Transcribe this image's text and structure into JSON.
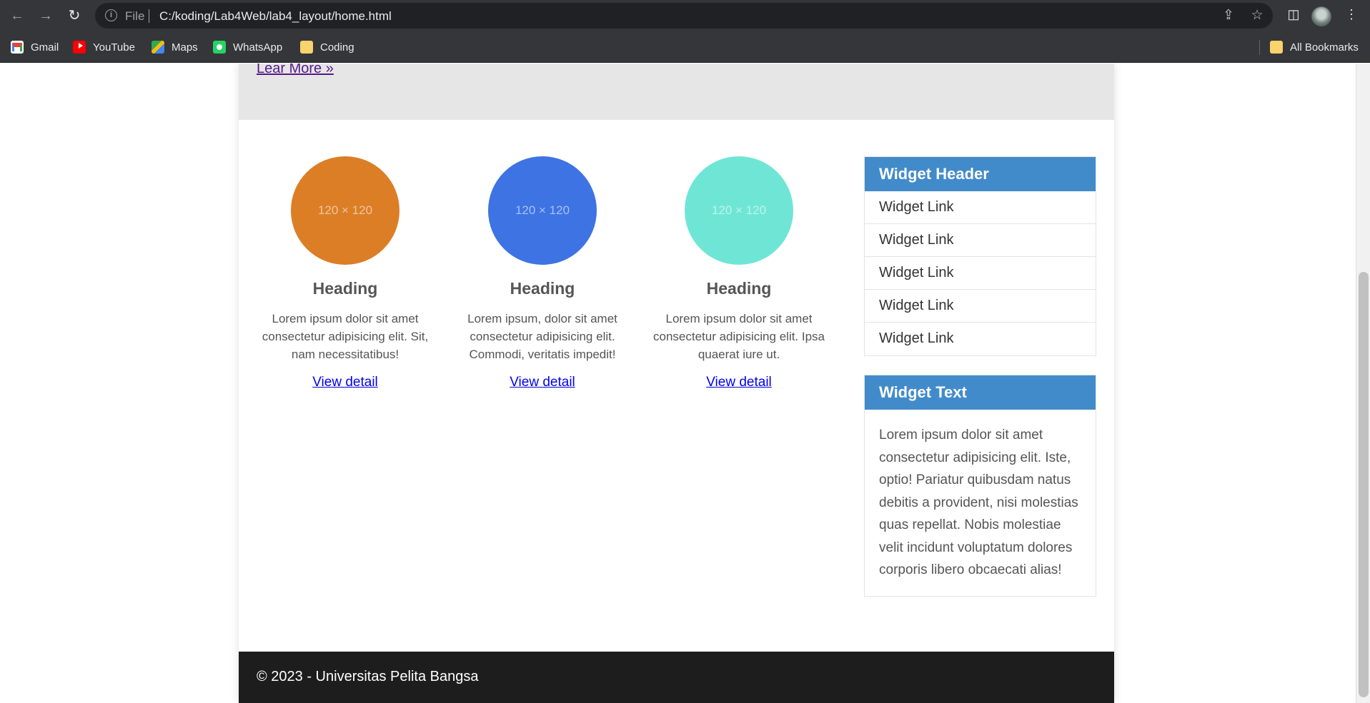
{
  "browser": {
    "back_icon": "back-arrow-icon",
    "forward_icon": "forward-arrow-icon",
    "reload_icon": "reload-icon",
    "url_scheme": "File",
    "url": "C:/koding/Lab4Web/lab4_layout/home.html",
    "bookmarks": [
      {
        "label": "Gmail",
        "icon": "gmail-icon"
      },
      {
        "label": "YouTube",
        "icon": "youtube-icon"
      },
      {
        "label": "Maps",
        "icon": "maps-icon"
      },
      {
        "label": "WhatsApp",
        "icon": "whatsapp-icon"
      },
      {
        "label": "Coding",
        "icon": "folder-icon"
      }
    ],
    "all_bookmarks": "All Bookmarks"
  },
  "hero": {
    "link": "Lear More »"
  },
  "columns": [
    {
      "image_label": "120 × 120",
      "color": "#dc7e26",
      "heading": "Heading",
      "text": "Lorem ipsum dolor sit amet consectetur adipisicing elit. Sit, nam necessitatibus!",
      "link": "View detail"
    },
    {
      "image_label": "120 × 120",
      "color": "#3d73e3",
      "heading": "Heading",
      "text": "Lorem ipsum, dolor sit amet consectetur adipisicing elit. Commodi, veritatis impedit!",
      "link": "View detail"
    },
    {
      "image_label": "120 × 120",
      "color": "#6fe6d5",
      "heading": "Heading",
      "text": "Lorem ipsum dolor sit amet consectetur adipisicing elit. Ipsa quaerat iure ut.",
      "link": "View detail"
    }
  ],
  "sidebar": {
    "widget1": {
      "header": "Widget Header",
      "links": [
        "Widget Link",
        "Widget Link",
        "Widget Link",
        "Widget Link",
        "Widget Link"
      ]
    },
    "widget2": {
      "header": "Widget Text",
      "text": "Lorem ipsum dolor sit amet consectetur adipisicing elit. Iste, optio! Pariatur quibusdam natus debitis a provident, nisi molestias quas repellat. Nobis molestiae velit incidunt voluptatum dolores corporis libero obcaecati alias!"
    }
  },
  "footer": {
    "text": "© 2023 - Universitas Pelita Bangsa"
  }
}
